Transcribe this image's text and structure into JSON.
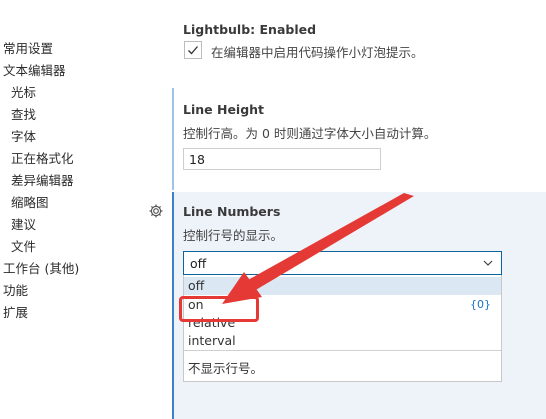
{
  "toc": [
    {
      "label": "常用设置",
      "id": "common"
    },
    {
      "label": "文本编辑器",
      "id": "text-editor"
    },
    {
      "label": "光标",
      "id": "cursor"
    },
    {
      "label": "查找",
      "id": "find"
    },
    {
      "label": "字体",
      "id": "font"
    },
    {
      "label": "正在格式化",
      "id": "formatting"
    },
    {
      "label": "差异编辑器",
      "id": "diff-editor"
    },
    {
      "label": "缩略图",
      "id": "minimap"
    },
    {
      "label": "建议",
      "id": "suggestions"
    },
    {
      "label": "文件",
      "id": "files"
    },
    {
      "label": "工作台 (其他)",
      "id": "workbench"
    },
    {
      "label": "功能",
      "id": "features"
    },
    {
      "label": "扩展",
      "id": "extensions"
    }
  ],
  "lightbulb": {
    "title": "Lightbulb: Enabled",
    "checkbox_label": "在编辑器中启用代码操作小灯泡提示。",
    "checked": true
  },
  "line_height": {
    "title": "Line Height",
    "description": "控制行高。为 0 时则通过字体大小自动计算。",
    "value": "18"
  },
  "line_numbers": {
    "title": "Line Numbers",
    "description": "控制行号的显示。",
    "selected": "off",
    "options": [
      {
        "label": "off",
        "badge": ""
      },
      {
        "label": "on",
        "badge": "{0}"
      },
      {
        "label": "relative",
        "badge": ""
      },
      {
        "label": "interval",
        "badge": ""
      }
    ],
    "option_description": "不显示行号。"
  },
  "colors": {
    "annotation": "#e53935",
    "focus_border": "#3b82c9",
    "badge": "#1a73c5"
  }
}
